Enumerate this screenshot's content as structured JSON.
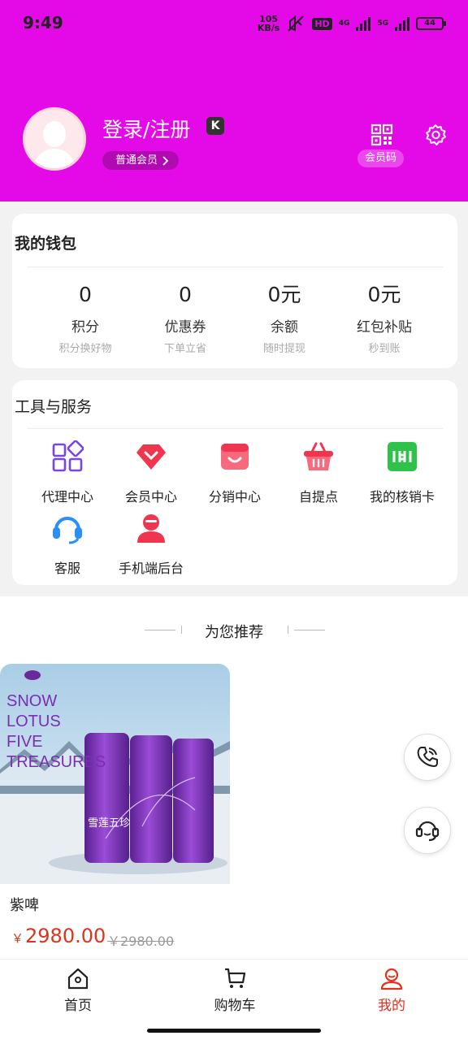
{
  "status_bar": {
    "time": "9:49",
    "net_speed_value": "105",
    "net_speed_unit": "KB/s",
    "hd": "HD",
    "net1": "4G",
    "net2": "5G",
    "battery": "44"
  },
  "profile": {
    "login_text": "登录/注册",
    "badge": "K",
    "member_level": "普通会员",
    "member_code_label": "会员码"
  },
  "wallet": {
    "title": "我的钱包",
    "items": [
      {
        "value": "0",
        "label": "积分",
        "sub": "积分换好物"
      },
      {
        "value": "0",
        "label": "优惠券",
        "sub": "下单立省"
      },
      {
        "value": "0元",
        "label": "余额",
        "sub": "随时提现"
      },
      {
        "value": "0元",
        "label": "红包补贴",
        "sub": "秒到账"
      }
    ]
  },
  "tools": {
    "title": "工具与服务",
    "items": [
      {
        "label": "代理中心",
        "icon": "agent-center-icon"
      },
      {
        "label": "会员中心",
        "icon": "member-center-icon"
      },
      {
        "label": "分销中心",
        "icon": "distribution-center-icon"
      },
      {
        "label": "自提点",
        "icon": "pickup-basket-icon"
      },
      {
        "label": "我的核销卡",
        "icon": "verification-card-icon"
      },
      {
        "label": "客服",
        "icon": "headset-icon"
      },
      {
        "label": "手机端后台",
        "icon": "mobile-admin-icon"
      }
    ]
  },
  "recommend": {
    "title": "为您推荐",
    "product": {
      "name": "紫啤",
      "currency": "￥",
      "price": "2980.00",
      "original_price": "￥2980.00",
      "image_text": [
        "SNOW",
        "LOTUS",
        "FIVE",
        "TREASURES"
      ],
      "can_text": "雪莲五珍"
    }
  },
  "float_buttons": {
    "phone": "phone-icon",
    "service": "customer-service-icon"
  },
  "tabbar": {
    "items": [
      {
        "label": "首页",
        "icon": "home-icon"
      },
      {
        "label": "购物车",
        "icon": "cart-icon"
      },
      {
        "label": "我的",
        "icon": "profile-icon"
      }
    ],
    "active": 2
  },
  "colors": {
    "header": "#e40ae7",
    "price": "#e0321c",
    "tool_purple": "#7a45e6",
    "tool_red": "#f0354e",
    "tool_green": "#2fc24a",
    "tool_blue": "#2c8ff5"
  }
}
